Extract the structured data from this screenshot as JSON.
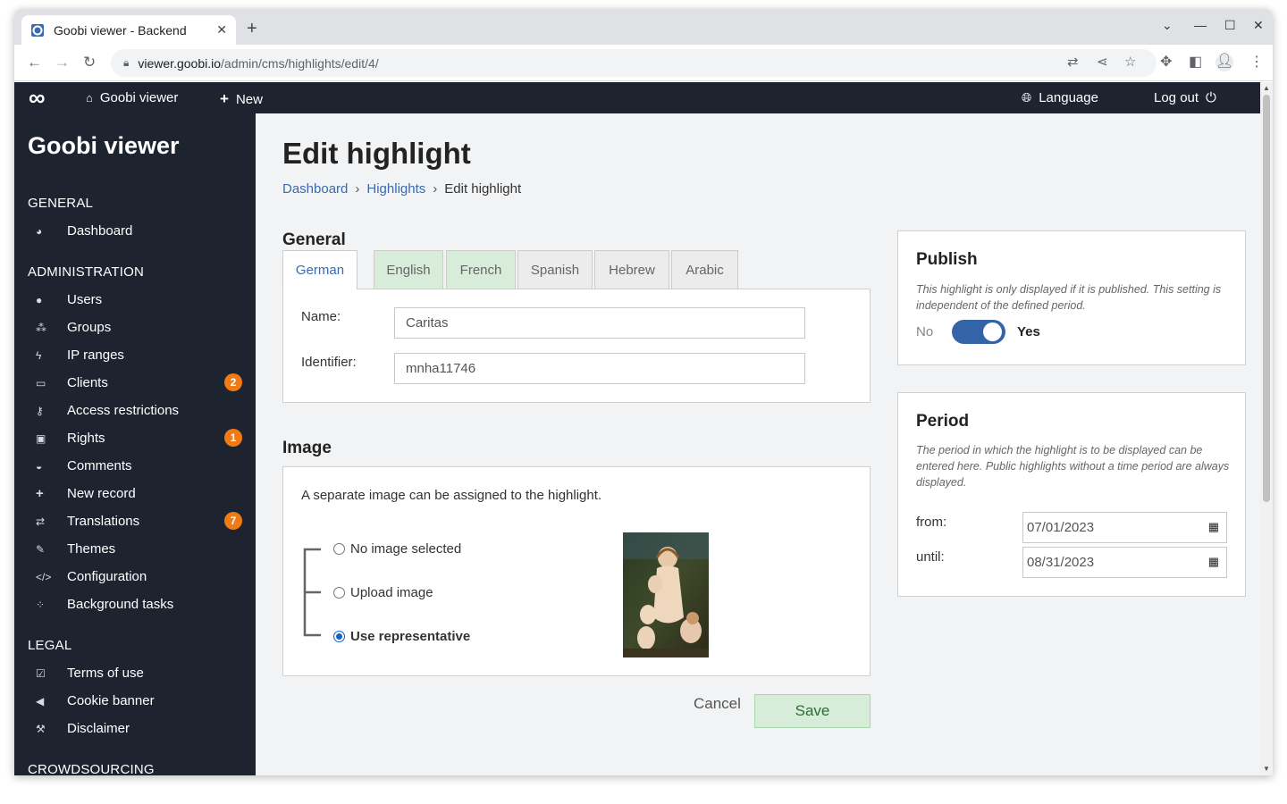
{
  "browser": {
    "tab_title": "Goobi viewer - Backend",
    "new_tab": "+",
    "url_host": "viewer.goobi.io",
    "url_path": "/admin/cms/highlights/edit/4/"
  },
  "topnav": {
    "home": "Goobi viewer",
    "new": "New",
    "language": "Language",
    "logout": "Log out"
  },
  "sidebar": {
    "brand": "Goobi viewer",
    "sections": {
      "general": "GENERAL",
      "administration": "ADMINISTRATION",
      "legal": "LEGAL",
      "crowdsourcing": "CROWDSOURCING"
    },
    "general_items": [
      {
        "label": "Dashboard",
        "icon": "dashboard-icon"
      }
    ],
    "admin_items": [
      {
        "label": "Users",
        "icon": "user-icon"
      },
      {
        "label": "Groups",
        "icon": "groups-icon"
      },
      {
        "label": "IP ranges",
        "icon": "bolt-icon"
      },
      {
        "label": "Clients",
        "icon": "monitor-icon",
        "badge": "2"
      },
      {
        "label": "Access restrictions",
        "icon": "key-icon"
      },
      {
        "label": "Rights",
        "icon": "lock-icon",
        "badge": "1"
      },
      {
        "label": "Comments",
        "icon": "comments-icon"
      },
      {
        "label": "New record",
        "icon": "plus-icon"
      },
      {
        "label": "Translations",
        "icon": "exchange-icon",
        "badge": "7"
      },
      {
        "label": "Themes",
        "icon": "brush-icon"
      },
      {
        "label": "Configuration",
        "icon": "code-icon"
      },
      {
        "label": "Background tasks",
        "icon": "spinner-icon"
      }
    ],
    "legal_items": [
      {
        "label": "Terms of use",
        "icon": "checklist-icon"
      },
      {
        "label": "Cookie banner",
        "icon": "megaphone-icon"
      },
      {
        "label": "Disclaimer",
        "icon": "gavel-icon"
      }
    ]
  },
  "page": {
    "title": "Edit highlight",
    "breadcrumb": [
      "Dashboard",
      "Highlights",
      "Edit highlight"
    ],
    "general_heading": "General",
    "language_tabs": [
      "German",
      "English",
      "French",
      "Spanish",
      "Hebrew",
      "Arabic"
    ],
    "name_label": "Name:",
    "name_value": "Caritas",
    "identifier_label": "Identifier:",
    "identifier_value": "mnha11746",
    "image_heading": "Image",
    "image_desc": "A separate image can be assigned to the highlight.",
    "image_options": [
      "No image selected",
      "Upload image",
      "Use representative"
    ],
    "selected_option": "Use representative",
    "cancel": "Cancel",
    "save": "Save"
  },
  "publish": {
    "heading": "Publish",
    "desc": "This highlight is only displayed if it is published. This setting is independent of the defined period.",
    "no": "No",
    "yes": "Yes",
    "published": true
  },
  "period": {
    "heading": "Period",
    "desc": "The period in which the highlight is to be displayed can be entered here. Public highlights without a time period are always displayed.",
    "from_label": "from:",
    "from_value": "07/01/2023",
    "until_label": "until:",
    "until_value": "08/31/2023"
  },
  "colors": {
    "sidebar_bg": "#1d2430",
    "badge": "#f07b15",
    "link": "#3a6bb0",
    "save_bg": "#d7ecd9",
    "toggle_on": "#3563a8"
  }
}
